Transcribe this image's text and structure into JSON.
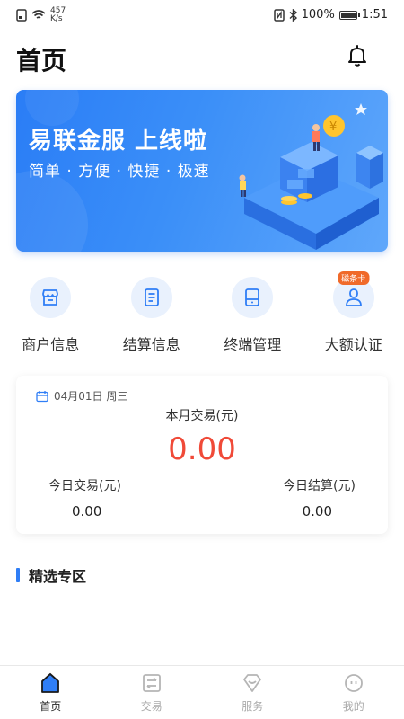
{
  "status_bar": {
    "speed_value": "457",
    "speed_unit": "K/s",
    "battery": "100%",
    "time": "1:51"
  },
  "header": {
    "title": "首页"
  },
  "banner": {
    "title": "易联金服  上线啦",
    "subtitle": "简单 · 方便 · 快捷 · 极速"
  },
  "quick_actions": [
    {
      "label": "商户信息",
      "icon": "storefront-icon"
    },
    {
      "label": "结算信息",
      "icon": "document-icon"
    },
    {
      "label": "终端管理",
      "icon": "terminal-icon"
    },
    {
      "label": "大额认证",
      "icon": "user-verify-icon",
      "badge": "磁条卡"
    }
  ],
  "summary_card": {
    "date": "04月01日 周三",
    "month_label": "本月交易(元)",
    "month_value": "0.00",
    "today_trade_label": "今日交易(元)",
    "today_trade_value": "0.00",
    "today_settle_label": "今日结算(元)",
    "today_settle_value": "0.00"
  },
  "section": {
    "title": "精选专区"
  },
  "tabbar": [
    {
      "label": "首页",
      "icon": "home-icon",
      "active": true
    },
    {
      "label": "交易",
      "icon": "transaction-icon",
      "active": false
    },
    {
      "label": "服务",
      "icon": "service-icon",
      "active": false
    },
    {
      "label": "我的",
      "icon": "profile-icon",
      "active": false
    }
  ],
  "colors": {
    "accent": "#2f7ef6",
    "amount_red": "#f04a38",
    "badge_orange": "#f06a2a"
  }
}
